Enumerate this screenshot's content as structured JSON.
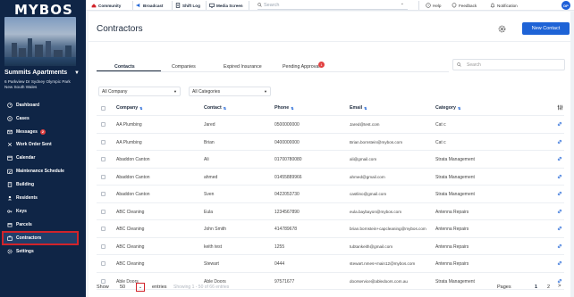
{
  "sidebar": {
    "logo": "MYBOS",
    "building_name": "Summits Apartments",
    "building_address": "6 Parkview Dr Sydney Olympic Park New South Wales",
    "items": [
      {
        "label": "Dashboard",
        "icon": "dashboard-icon"
      },
      {
        "label": "Cases",
        "icon": "cases-icon"
      },
      {
        "label": "Messages",
        "icon": "messages-icon",
        "badge": "2"
      },
      {
        "label": "Work Order Sent",
        "icon": "work-order-icon"
      },
      {
        "label": "Calendar",
        "icon": "calendar-icon"
      },
      {
        "label": "Maintenance Schedule",
        "icon": "maintenance-icon"
      },
      {
        "label": "Building",
        "icon": "building-icon"
      },
      {
        "label": "Residents",
        "icon": "residents-icon"
      },
      {
        "label": "Keys",
        "icon": "keys-icon"
      },
      {
        "label": "Parcels",
        "icon": "parcels-icon"
      },
      {
        "label": "Contractors",
        "icon": "contractors-icon",
        "active": true
      },
      {
        "label": "Settings",
        "icon": "settings-icon"
      }
    ]
  },
  "topbar": {
    "community": "Community",
    "broadcast": "Broadcast",
    "shift_log": "Shift Log",
    "media_screen": "Media Screen",
    "search_placeholder": "Search",
    "help": "Help",
    "feedback": "Feedback",
    "notification": "Notification",
    "avatar_initials": "DP"
  },
  "page": {
    "title": "Contractors",
    "new_button": "New Contact",
    "tabs": [
      "Contacts",
      "Companies",
      "Expired Insurance",
      "Pending Approval"
    ],
    "pending_badge": "1",
    "search_placeholder": "Search",
    "filter_company": "All Company",
    "filter_category": "All Categories"
  },
  "table": {
    "headers": {
      "company": "Company",
      "contact": "Contact",
      "phone": "Phone",
      "email": "Email",
      "category": "Category"
    },
    "rows": [
      {
        "company": "AA Plumbing",
        "contact": "Jared",
        "phone": "0500000000",
        "email": "Jared@test.com",
        "category": "Cat c"
      },
      {
        "company": "AA Plumbing",
        "contact": "Brian",
        "phone": "0400000000",
        "email": "Brian.bornstein@mybos.com",
        "category": "Cat c"
      },
      {
        "company": "Abaddon Canton",
        "contact": "Ali",
        "phone": "01700780080",
        "email": "ali@gmail.com",
        "category": "Strata Management"
      },
      {
        "company": "Abaddon Canton",
        "contact": "ahmed",
        "phone": "01455889966",
        "email": "ahmed@gmail.com",
        "category": "Strata Management"
      },
      {
        "company": "Abaddon Canton",
        "contact": "Sven",
        "phone": "0422053730",
        "email": "castlino@gmail.com",
        "category": "Strata Management"
      },
      {
        "company": "ABC Cleaning",
        "contact": "Eula",
        "phone": "1234567890",
        "email": "eula.baybayon@mybos.com",
        "category": "Antenna Repairs"
      },
      {
        "company": "ABC Cleaning",
        "contact": "John Smith",
        "phone": "414789678",
        "email": "brian.bornstein+capcleaning@mybos.com",
        "category": "Antenna Repairs"
      },
      {
        "company": "ABC Cleaning",
        "contact": "keith test",
        "phone": "1255",
        "email": "tubtankeith@gmail.com",
        "category": "Antenna Repairs"
      },
      {
        "company": "ABC Cleaning",
        "contact": "Stewart",
        "phone": "0444",
        "email": "stewart.nmes+main12@mybos.com",
        "category": "Antenna Repairs"
      },
      {
        "company": "Able Doors",
        "contact": "Able Doors",
        "phone": "97571677",
        "email": "doorservice@abledoors.com.au",
        "category": "Strata Management"
      }
    ]
  },
  "footer": {
    "show": "Show",
    "page_size": "50",
    "entries": "entries",
    "showing": "Showing 1 - 50 of 66 entries",
    "pages_label": "Pages",
    "pages": [
      "1",
      "2"
    ],
    "next": ">"
  },
  "colors": {
    "sidebar": "#0f2546",
    "accent": "#1e63d6",
    "highlight": "#d1232a",
    "badge": "#e24141"
  }
}
